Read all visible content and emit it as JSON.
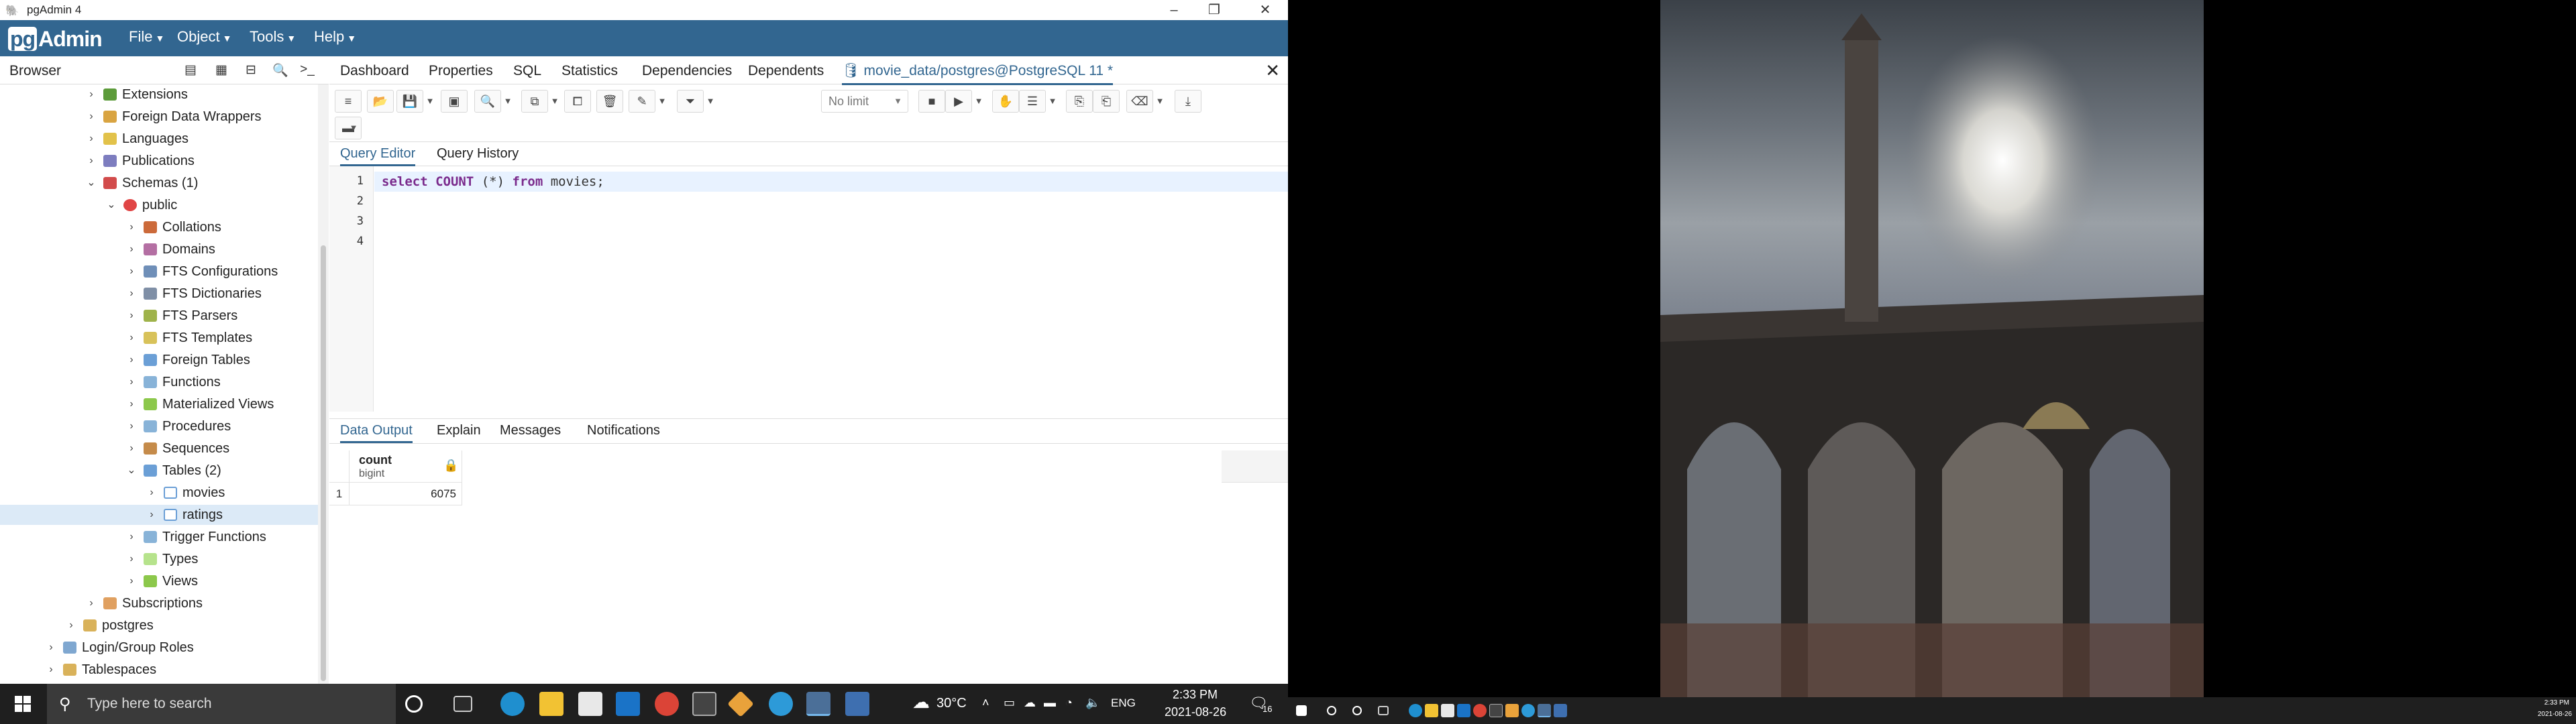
{
  "app": {
    "title": "pgAdmin 4",
    "brand": "Admin",
    "brand_prefix": "pg"
  },
  "menu": [
    {
      "label": "File"
    },
    {
      "label": "Object"
    },
    {
      "label": "Tools"
    },
    {
      "label": "Help"
    }
  ],
  "browser": {
    "title": "Browser",
    "tree": [
      {
        "label": "Extensions"
      },
      {
        "label": "Foreign Data Wrappers"
      },
      {
        "label": "Languages"
      },
      {
        "label": "Publications"
      },
      {
        "label": "Schemas (1)"
      },
      {
        "label": "public"
      },
      {
        "label": "Collations"
      },
      {
        "label": "Domains"
      },
      {
        "label": "FTS Configurations"
      },
      {
        "label": "FTS Dictionaries"
      },
      {
        "label": "FTS Parsers"
      },
      {
        "label": "FTS Templates"
      },
      {
        "label": "Foreign Tables"
      },
      {
        "label": "Functions"
      },
      {
        "label": "Materialized Views"
      },
      {
        "label": "Procedures"
      },
      {
        "label": "Sequences"
      },
      {
        "label": "Tables (2)"
      },
      {
        "label": "movies"
      },
      {
        "label": "ratings"
      },
      {
        "label": "Trigger Functions"
      },
      {
        "label": "Types"
      },
      {
        "label": "Views"
      },
      {
        "label": "Subscriptions"
      },
      {
        "label": "postgres"
      },
      {
        "label": "Login/Group Roles"
      },
      {
        "label": "Tablespaces"
      }
    ]
  },
  "tabs": [
    {
      "label": "Dashboard"
    },
    {
      "label": "Properties"
    },
    {
      "label": "SQL"
    },
    {
      "label": "Statistics"
    },
    {
      "label": "Dependencies"
    },
    {
      "label": "Dependents"
    },
    {
      "label": "movie_data/postgres@PostgreSQL 11 *"
    }
  ],
  "toolbar": {
    "limit": "No limit"
  },
  "editor_tabs": [
    {
      "label": "Query Editor"
    },
    {
      "label": "Query History"
    }
  ],
  "editor": {
    "line_numbers": [
      "1",
      "2",
      "3",
      "4"
    ],
    "code": {
      "kw1": "select",
      "fn": "COUNT",
      "args": " (*) ",
      "kw2": "from",
      "rest": " movies;"
    }
  },
  "result_tabs": [
    {
      "label": "Data Output"
    },
    {
      "label": "Explain"
    },
    {
      "label": "Messages"
    },
    {
      "label": "Notifications"
    }
  ],
  "results": {
    "column": {
      "name": "count",
      "type": "bigint"
    },
    "rows": [
      {
        "n": "1",
        "value": "6075"
      }
    ]
  },
  "taskbar": {
    "search_placeholder": "Type here to search",
    "weather": "30°C",
    "lang": "ENG",
    "time": "2:33 PM",
    "date": "2021-08-26",
    "notif_count": "16"
  },
  "taskbar2": {
    "time": "2:33 PM",
    "date": "2021-08-26"
  }
}
